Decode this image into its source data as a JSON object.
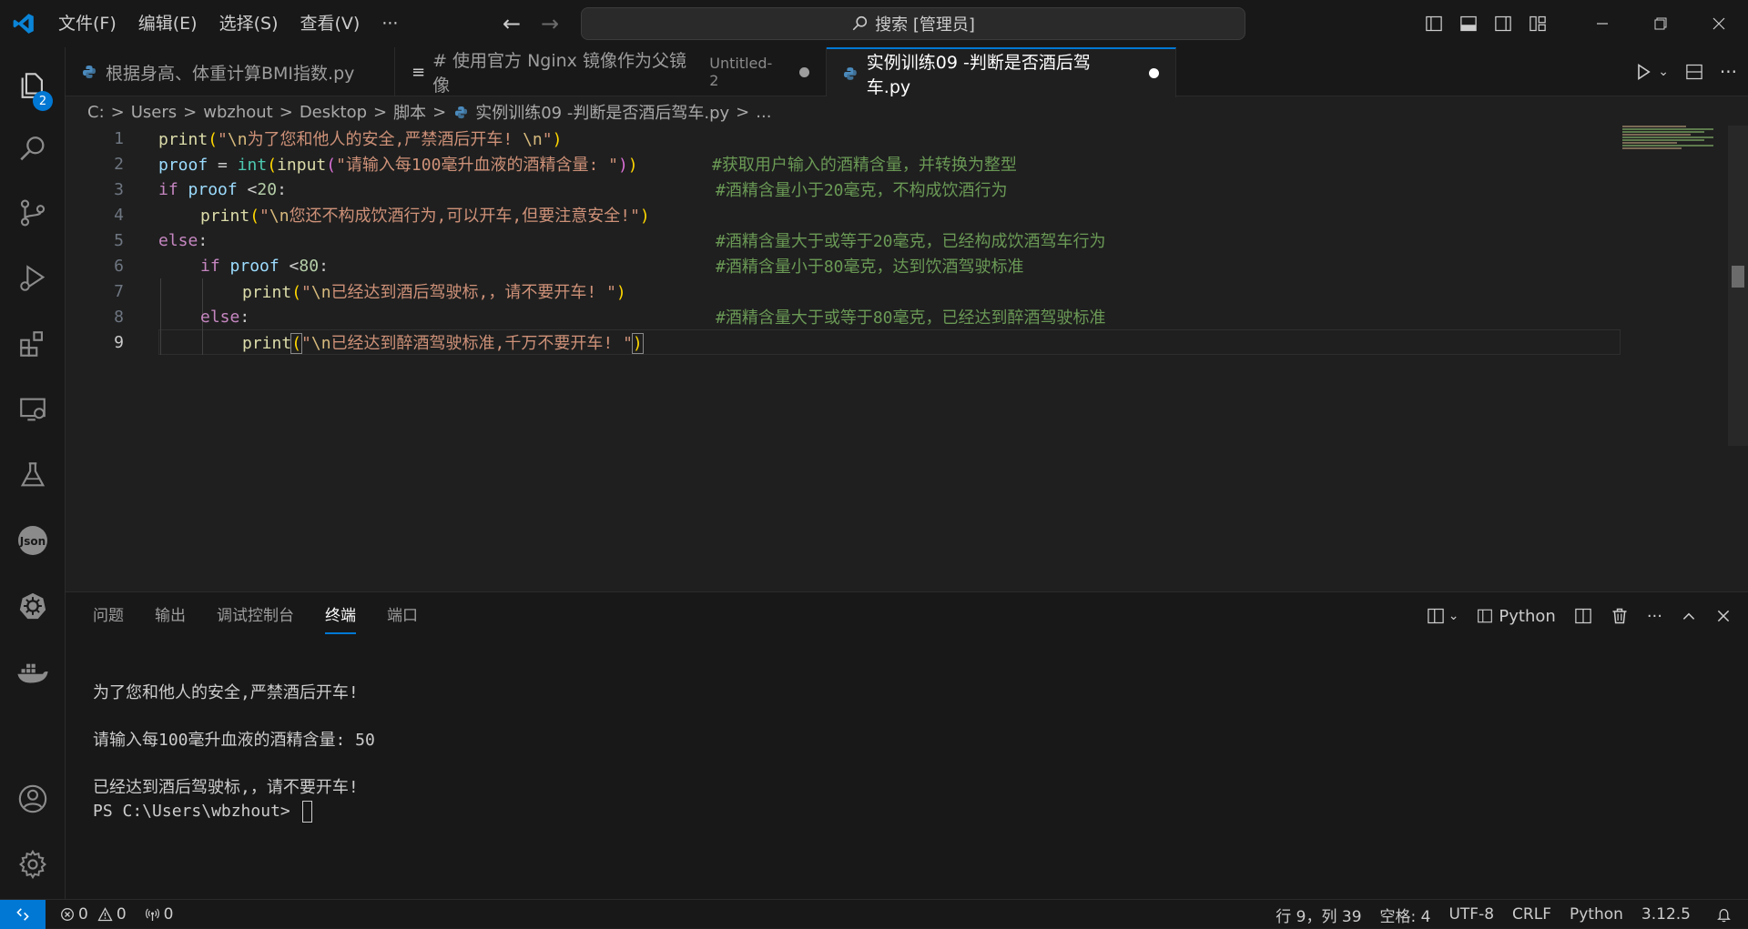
{
  "menu": [
    "文件(F)",
    "编辑(E)",
    "选择(S)",
    "查看(V)",
    "···"
  ],
  "search": {
    "text": "搜索 [管理员]"
  },
  "activity": {
    "explorer_badge": "2",
    "json_label": "Json"
  },
  "tabs": [
    {
      "label": "根据身高、体重计算BMI指数.py",
      "desc": ""
    },
    {
      "label": "# 使用官方 Nginx 镜像作为父镜像",
      "desc": "Untitled-2"
    },
    {
      "label": "实例训练09 -判断是否酒后驾车.py",
      "desc": ""
    }
  ],
  "breadcrumb": [
    "C:",
    "Users",
    "wbzhout",
    "Desktop",
    "脚本",
    "实例训练09 -判断是否酒后驾车.py",
    "..."
  ],
  "editor": {
    "line_numbers": [
      "1",
      "2",
      "3",
      "4",
      "5",
      "6",
      "7",
      "8",
      "9"
    ],
    "lines": {
      "l1_fn": "print",
      "l1_str": "\"",
      "l1_esc": "\\n",
      "l1_str2": "为了您和他人的安全,严禁酒后开车! ",
      "l1_esc2": "\\n",
      "l1_str3": "\"",
      "l2_var": "proof",
      "l2_eq": " = ",
      "l2_int": "int",
      "l2_input": "input",
      "l2_str": "\"请输入每100毫升血液的酒精含量: \"",
      "l2_cmt": "#获取用户输入的酒精含量，并转换为整型",
      "l3_kw": "if",
      "l3_var": " proof ",
      "l3_op": "<",
      "l3_num": "20",
      "l3_colon": ":",
      "l3_cmt": "#酒精含量小于20毫克，不构成饮酒行为",
      "l4_fn": "print",
      "l4_str": "\"",
      "l4_esc": "\\n",
      "l4_str2": "您还不构成饮酒行为,可以开车,但要注意安全!\"",
      "l5_kw": "else",
      "l5_colon": ":",
      "l5_cmt": "#酒精含量大于或等于20毫克，已经构成饮酒驾车行为",
      "l6_kw": "if",
      "l6_var": " proof ",
      "l6_op": "<",
      "l6_num": "80",
      "l6_colon": ":",
      "l6_cmt": "#酒精含量小于80毫克，达到饮酒驾驶标准",
      "l7_fn": "print",
      "l7_str": "\"",
      "l7_esc": "\\n",
      "l7_str2": "已经达到酒后驾驶标,，请不要开车! \"",
      "l8_kw": "else",
      "l8_colon": ":",
      "l8_cmt": "#酒精含量大于或等于80毫克，已经达到醉酒驾驶标准",
      "l9_fn": "print",
      "l9_str": "\"",
      "l9_esc": "\\n",
      "l9_str2": "已经达到醉酒驾驶标准,千万不要开车! \""
    }
  },
  "panel": {
    "tabs": [
      "问题",
      "输出",
      "调试控制台",
      "终端",
      "端口"
    ],
    "terminal_profile": "Python",
    "terminal_lines": [
      "为了您和他人的安全,严禁酒后开车!",
      "",
      "请输入每100毫升血液的酒精含量: 50",
      "",
      "已经达到酒后驾驶标,，请不要开车!"
    ],
    "prompt": "PS C:\\Users\\wbzhout> "
  },
  "status": {
    "errors": "0",
    "warnings": "0",
    "ports": "0",
    "position": "行 9，列 39",
    "spaces": "空格: 4",
    "encoding": "UTF-8",
    "eol": "CRLF",
    "language": "Python",
    "version": "3.12.5"
  },
  "colors": {
    "accent": "#0078d4",
    "comment": "#6a9955",
    "string": "#ce9178",
    "keyword": "#c586c0",
    "function": "#dcdcaa"
  }
}
